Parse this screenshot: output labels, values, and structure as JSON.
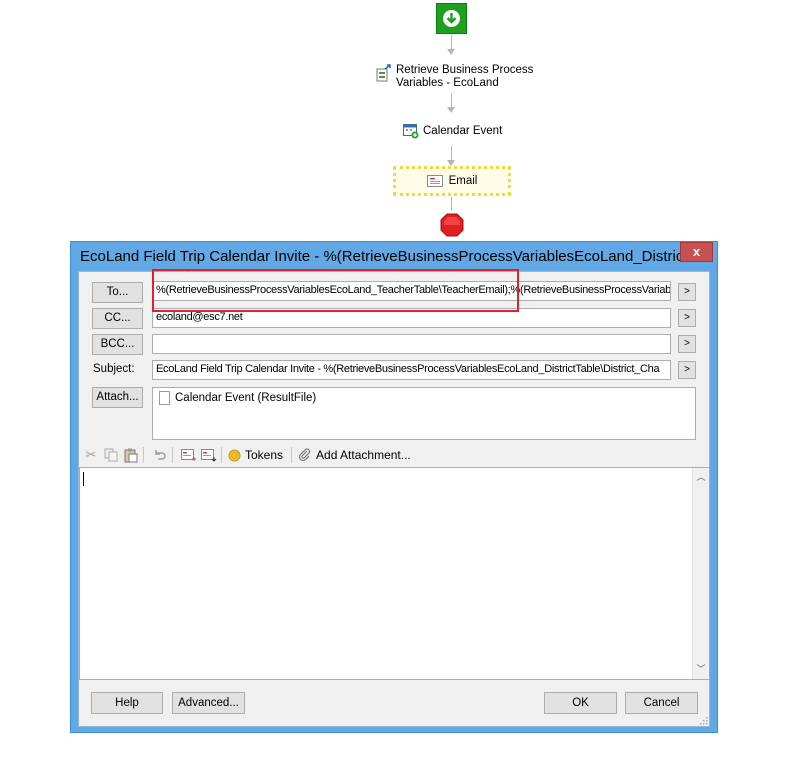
{
  "workflow": {
    "nodes": [
      {
        "label": "Retrieve Business Process\nVariables - EcoLand",
        "icon": "data-variables-icon"
      },
      {
        "label": "Calendar Event",
        "icon": "calendar-event-icon"
      },
      {
        "label": "Email",
        "icon": "email-icon"
      }
    ],
    "start_icon": "start-arrow-icon",
    "stop_icon": "stop-octagon-icon"
  },
  "dialog": {
    "title": "EcoLand Field Trip Calendar Invite - %(RetrieveBusinessProcessVariablesEcoLand_District...",
    "close_label": "x",
    "to_button": "To...",
    "to_value": "%(RetrieveBusinessProcessVariablesEcoLand_TeacherTable\\TeacherEmail);%(RetrieveBusinessProcessVariab",
    "cc_button": "CC...",
    "cc_value": "ecoland@esc7.net",
    "bcc_button": "BCC...",
    "bcc_value": "",
    "subject_label": "Subject:",
    "subject_value": "EcoLand Field Trip Calendar Invite - %(RetrieveBusinessProcessVariablesEcoLand_DistrictTable\\District_Cha",
    "attach_button": "Attach...",
    "attachments": [
      "Calendar Event (ResultFile)"
    ],
    "expand_label": ">",
    "toolbar": {
      "tokens_label": "Tokens",
      "add_attachment_label": "Add Attachment..."
    },
    "body_text": "",
    "buttons": {
      "help": "Help",
      "advanced": "Advanced...",
      "ok": "OK",
      "cancel": "Cancel"
    }
  },
  "colors": {
    "accent": "#62a8e5",
    "highlight": "#e0202a",
    "selected_node": "#e8dc4a"
  }
}
